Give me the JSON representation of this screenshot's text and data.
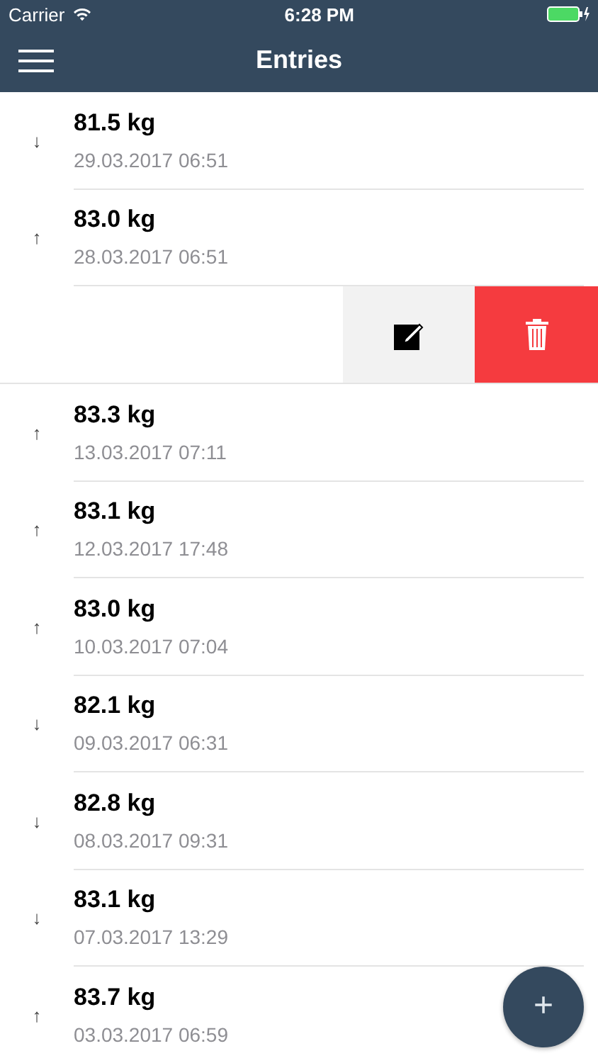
{
  "status_bar": {
    "carrier": "Carrier",
    "time": "6:28 PM"
  },
  "nav": {
    "title": "Entries"
  },
  "entries": [
    {
      "kind": "entry",
      "trend": "↓",
      "weight": "81.5 kg",
      "date": "29.03.2017 06:51"
    },
    {
      "kind": "entry",
      "trend": "↑",
      "weight": "83.0 kg",
      "date": "28.03.2017 06:51"
    },
    {
      "kind": "swiped"
    },
    {
      "kind": "entry",
      "trend": "↑",
      "weight": "83.3 kg",
      "date": "13.03.2017 07:11"
    },
    {
      "kind": "entry",
      "trend": "↑",
      "weight": "83.1 kg",
      "date": "12.03.2017 17:48"
    },
    {
      "kind": "entry",
      "trend": "↑",
      "weight": "83.0 kg",
      "date": "10.03.2017 07:04"
    },
    {
      "kind": "entry",
      "trend": "↓",
      "weight": "82.1 kg",
      "date": "09.03.2017 06:31"
    },
    {
      "kind": "entry",
      "trend": "↓",
      "weight": "82.8 kg",
      "date": "08.03.2017 09:31"
    },
    {
      "kind": "entry",
      "trend": "↓",
      "weight": "83.1 kg",
      "date": "07.03.2017 13:29"
    },
    {
      "kind": "entry",
      "trend": "↑",
      "weight": "83.7 kg",
      "date": "03.03.2017 06:59"
    }
  ],
  "fab": {
    "label": "+"
  }
}
